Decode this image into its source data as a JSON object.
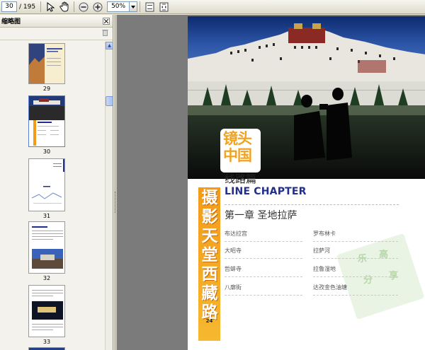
{
  "toolbar": {
    "current_page": "30",
    "page_total": "/ 195",
    "zoom": "50%",
    "icons": [
      "select-arrow-icon",
      "hand-icon",
      "zoom-out-icon",
      "zoom-in-icon",
      "fit-page-icon",
      "fit-width-icon"
    ]
  },
  "panel": {
    "title": "缩略图",
    "thumbnails": [
      {
        "label": "29"
      },
      {
        "label": "30"
      },
      {
        "label": "31"
      },
      {
        "label": "32"
      },
      {
        "label": "33"
      }
    ]
  },
  "page": {
    "tag_line1": "镜头",
    "tag_line2": "中国",
    "route": "线路篇",
    "chapter_en": "LINE CHAPTER",
    "vertical_title": "摄影天堂西藏路",
    "page_number": "24",
    "chapter_title": "第一章  圣地拉萨",
    "toc_left": [
      "布达拉宫",
      "大昭寺",
      "哲蚌寺",
      "八廓街"
    ],
    "toc_right": [
      "罗布林卡",
      "拉萨河",
      "拉鲁湿地",
      "达孜金色油塘"
    ],
    "watermark": [
      "乐",
      "高",
      "分",
      "享"
    ]
  },
  "colors": {
    "accent_orange": "#f39a1a",
    "title_blue": "#1f2e8f",
    "doc_background": "#7b7b7b"
  }
}
